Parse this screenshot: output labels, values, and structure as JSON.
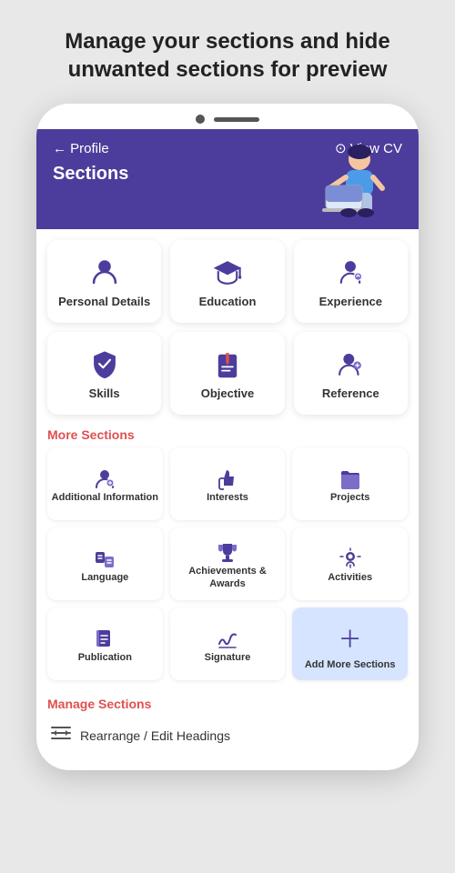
{
  "page": {
    "title_line1": "Manage your sections and hide",
    "title_line2": "unwanted sections for preview"
  },
  "phone": {
    "nav": {
      "back_label": "← Profile",
      "view_cv_label": "⊙ View CV",
      "sections_label": "Sections"
    }
  },
  "primary_sections": [
    {
      "id": "personal-details",
      "label": "Personal Details",
      "icon": "person"
    },
    {
      "id": "education",
      "label": "Education",
      "icon": "graduation"
    },
    {
      "id": "experience",
      "label": "Experience",
      "icon": "experience"
    }
  ],
  "secondary_sections_row1": [
    {
      "id": "skills",
      "label": "Skills",
      "icon": "shield"
    },
    {
      "id": "objective",
      "label": "Objective",
      "icon": "objective"
    },
    {
      "id": "reference",
      "label": "Reference",
      "icon": "reference"
    }
  ],
  "more_sections_title": "More Sections",
  "more_sections": [
    {
      "id": "additional-information",
      "label": "Additional Information",
      "icon": "person-plus"
    },
    {
      "id": "interests",
      "label": "Interests",
      "icon": "thumb-up"
    },
    {
      "id": "projects",
      "label": "Projects",
      "icon": "folder"
    },
    {
      "id": "language",
      "label": "Language",
      "icon": "language"
    },
    {
      "id": "achievements-awards",
      "label": "Achievements & Awards",
      "icon": "trophy"
    },
    {
      "id": "activities",
      "label": "Activities",
      "icon": "activities"
    },
    {
      "id": "publication",
      "label": "Publication",
      "icon": "book"
    },
    {
      "id": "signature",
      "label": "Signature",
      "icon": "signature"
    },
    {
      "id": "add-more-sections",
      "label": "Add More Sections",
      "icon": "plus",
      "highlighted": true
    }
  ],
  "manage_sections_title": "Manage Sections",
  "manage_items": [
    {
      "id": "rearrange-edit",
      "label": "Rearrange / Edit Headings",
      "icon": "rearrange"
    }
  ]
}
